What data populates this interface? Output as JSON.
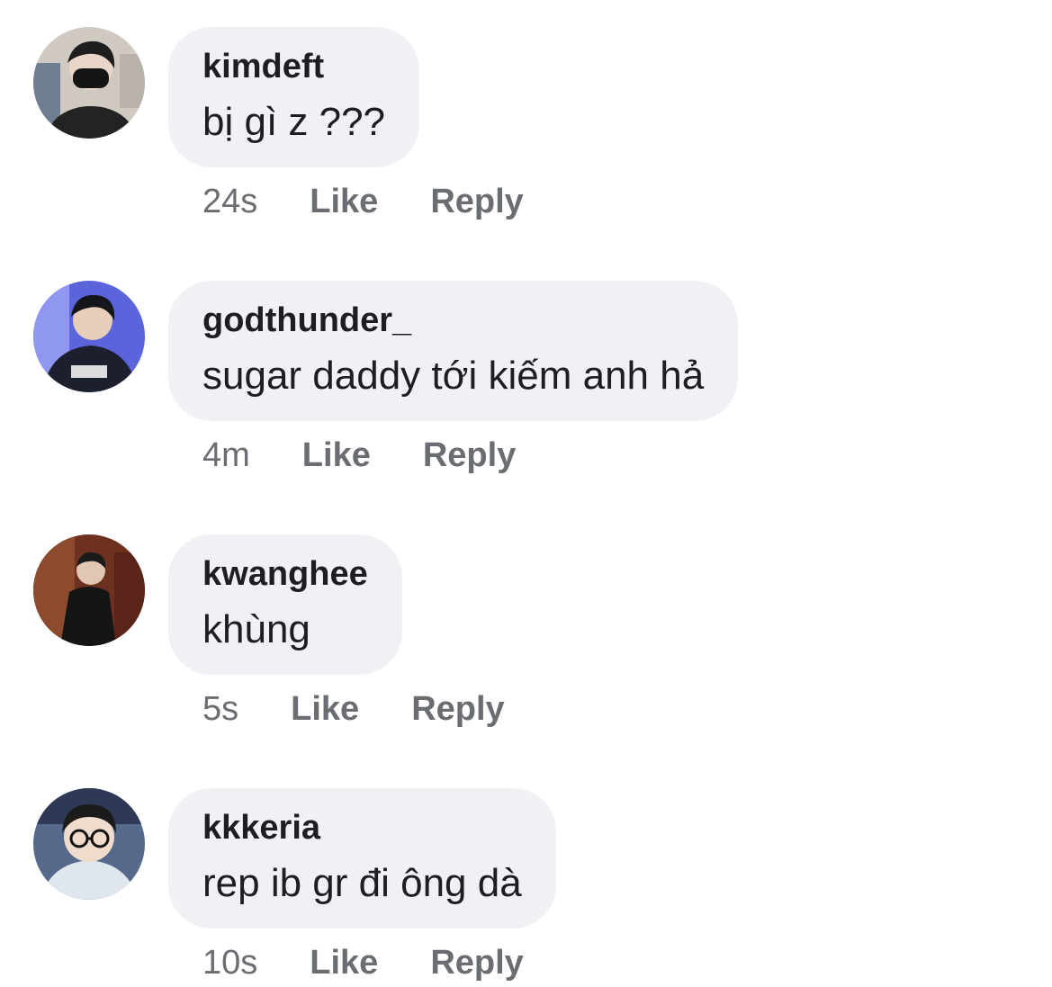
{
  "comments": [
    {
      "author": "kimdeft",
      "text": "bị gì z ???",
      "time": "24s",
      "like_label": "Like",
      "reply_label": "Reply",
      "avatar": {
        "bg": "#c9c3bc",
        "accent": "#2b2b2b",
        "skin": "#e9d6c8"
      }
    },
    {
      "author": "godthunder_",
      "text": "sugar daddy tới kiếm anh hả",
      "time": "4m",
      "like_label": "Like",
      "reply_label": "Reply",
      "avatar": {
        "bg": "#5a63d8",
        "accent": "#1b1f2e",
        "skin": "#e8cdb8"
      }
    },
    {
      "author": "kwanghee",
      "text": "khùng",
      "time": "5s",
      "like_label": "Like",
      "reply_label": "Reply",
      "avatar": {
        "bg": "#7a3a26",
        "accent": "#161616",
        "skin": "#e2c6b4"
      }
    },
    {
      "author": "kkkeria",
      "text": "rep ib gr đi ông dà",
      "time": "10s",
      "like_label": "Like",
      "reply_label": "Reply",
      "avatar": {
        "bg": "#5c6e8a",
        "accent": "#1e1e1e",
        "skin": "#f0dccd"
      }
    }
  ]
}
